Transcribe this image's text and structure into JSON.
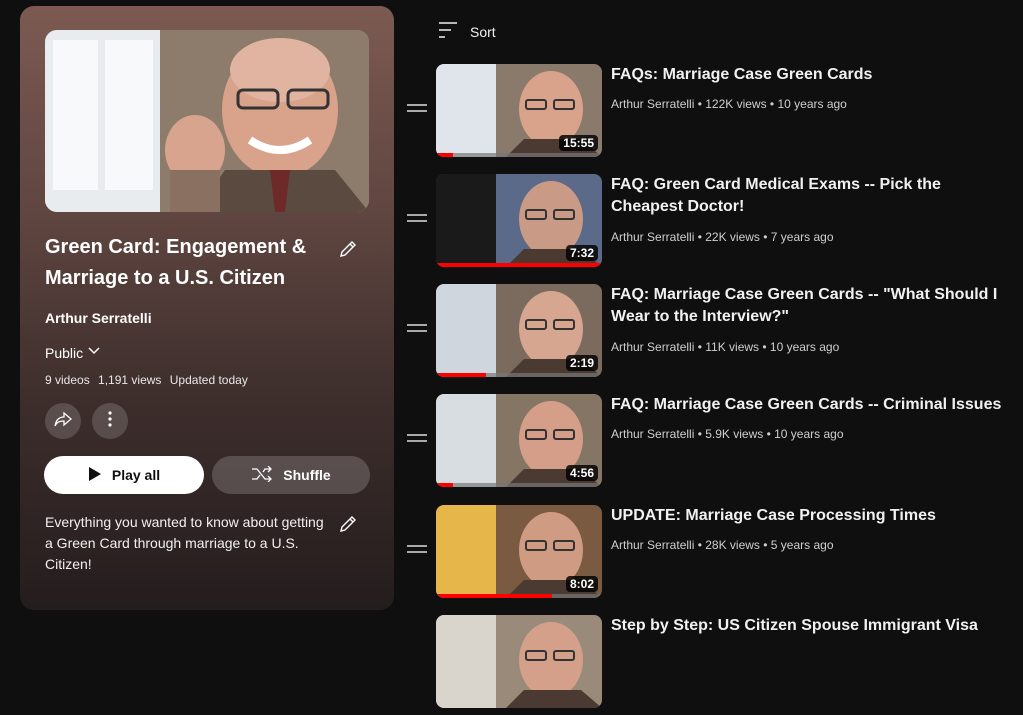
{
  "playlist": {
    "title": "Green Card: Engagement & Marriage to a U.S. Citizen",
    "owner": "Arthur Serratelli",
    "privacy": "Public",
    "stats": {
      "videos": "9 videos",
      "views": "1,191 views",
      "updated": "Updated today"
    },
    "play_all_label": "Play all",
    "shuffle_label": "Shuffle",
    "description": "Everything you wanted to know about getting a Green Card through marriage to a U.S. Citizen!"
  },
  "sort_label": "Sort",
  "videos": [
    {
      "title": "FAQs: Marriage Case Green Cards",
      "meta": "Arthur Serratelli • 122K views • 10 years ago",
      "duration": "15:55",
      "progress": 0.1
    },
    {
      "title": "FAQ: Green Card Medical Exams -- Pick the Cheapest Doctor!",
      "meta": "Arthur Serratelli • 22K views • 7 years ago",
      "duration": "7:32",
      "progress": 1.0
    },
    {
      "title": "FAQ: Marriage Case Green Cards -- \"What Should I Wear to the Interview?\"",
      "meta": "Arthur Serratelli • 11K views • 10 years ago",
      "duration": "2:19",
      "progress": 0.3
    },
    {
      "title": "FAQ: Marriage Case Green Cards -- Criminal Issues",
      "meta": "Arthur Serratelli • 5.9K views • 10 years ago",
      "duration": "4:56",
      "progress": 0.1
    },
    {
      "title": "UPDATE: Marriage Case Processing Times",
      "meta": "Arthur Serratelli • 28K views • 5 years ago",
      "duration": "8:02",
      "progress": 0.7
    },
    {
      "title": "Step by Step: US Citizen Spouse Immigrant Visa",
      "meta": "",
      "duration": "",
      "progress": 0
    }
  ],
  "icons": {
    "edit": "pencil-icon",
    "share": "share-icon",
    "more": "more-vert-icon",
    "play": "play-icon",
    "shuffle": "shuffle-icon",
    "sort": "sort-icon",
    "drag": "drag-handle-icon",
    "privacy_dropdown": "chevron-down-icon"
  },
  "colors": {
    "background": "#0f0f0f",
    "progress": "#ff0000",
    "panel_top": "#7c5a52",
    "panel_bottom": "#241d1d"
  }
}
